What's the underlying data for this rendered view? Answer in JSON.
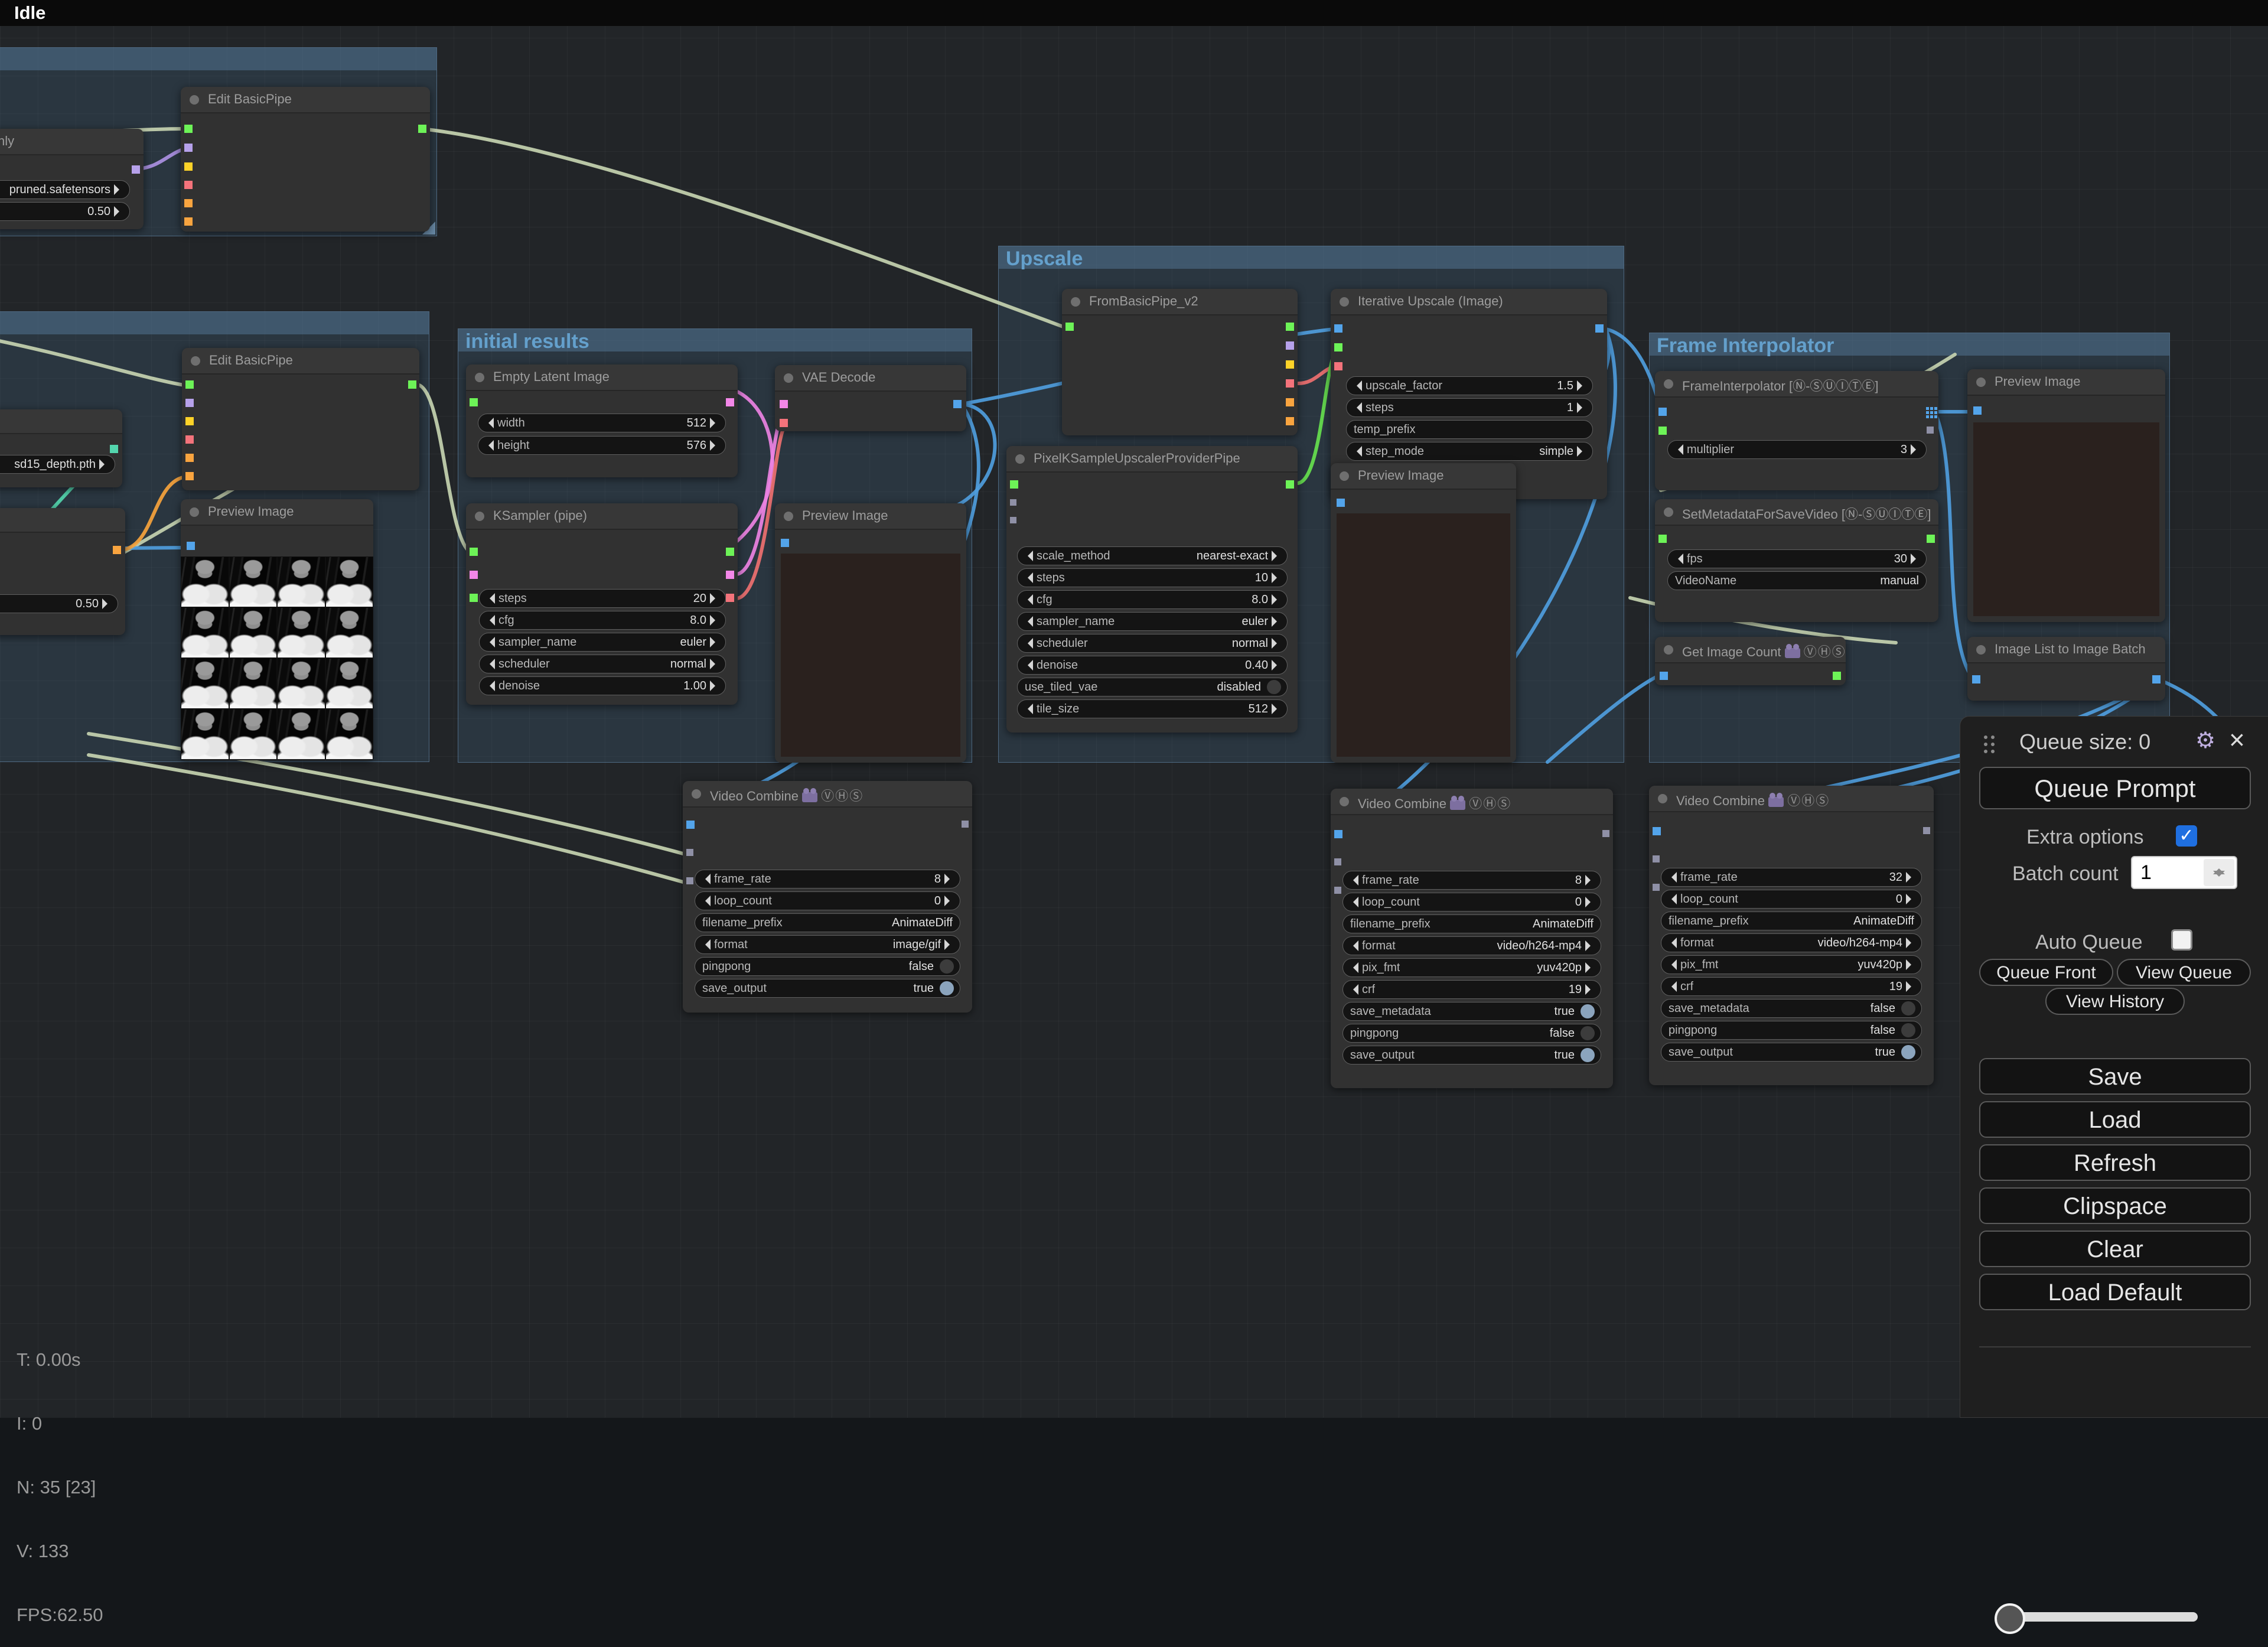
{
  "status_bar": {
    "state": "Idle"
  },
  "palette": {
    "wire_pipe": "#c6d2b0",
    "wire_image": "#4f9ddd",
    "wire_latent": "#ec82e2",
    "wire_vae": "#ee7070",
    "wire_model": "#66e04e",
    "wire_controlnet": "#f6a33c",
    "wire_clip": "#ab90e2",
    "wire_cond": "#54d6ae",
    "group_accent": "#64a0cc",
    "toggle_on": "#8ba4bd",
    "checkbox_on": "#1f6fe0"
  },
  "groups": {
    "initial_results": {
      "title": "initial results"
    },
    "upscale": {
      "title": "Upscale"
    },
    "frame_interpolator": {
      "title": "Frame Interpolator"
    }
  },
  "nodes": {
    "ckpt_partial": {
      "title": "nly",
      "widgets": {
        "ckpt": {
          "value": "pruned.safetensors"
        },
        "ratio": {
          "value": "0.50"
        }
      }
    },
    "edit_basic_pipe_1": {
      "title": "Edit BasicPipe"
    },
    "edit_basic_pipe_2": {
      "title": "Edit BasicPipe"
    },
    "controlnet_partial": {
      "widgets": {
        "model": {
          "value": "sd15_depth.pth"
        }
      }
    },
    "strength_partial": {
      "widgets": {
        "strength": {
          "value": "0.50"
        }
      }
    },
    "preview_left": {
      "title": "Preview Image"
    },
    "empty_latent": {
      "title": "Empty Latent Image",
      "widgets": {
        "width": {
          "label": "width",
          "value": "512"
        },
        "height": {
          "label": "height",
          "value": "576"
        }
      }
    },
    "vae_decode": {
      "title": "VAE Decode"
    },
    "ksampler": {
      "title": "KSampler (pipe)",
      "widgets": {
        "steps": {
          "label": "steps",
          "value": "20"
        },
        "cfg": {
          "label": "cfg",
          "value": "8.0"
        },
        "sampler_name": {
          "label": "sampler_name",
          "value": "euler"
        },
        "scheduler": {
          "label": "scheduler",
          "value": "normal"
        },
        "denoise": {
          "label": "denoise",
          "value": "1.00"
        }
      }
    },
    "preview_initial": {
      "title": "Preview Image"
    },
    "from_basic_pipe": {
      "title": "FromBasicPipe_v2"
    },
    "iterative_upscale": {
      "title": "Iterative Upscale (Image)",
      "widgets": {
        "upscale_factor": {
          "label": "upscale_factor",
          "value": "1.5"
        },
        "steps": {
          "label": "steps",
          "value": "1"
        },
        "temp_prefix": {
          "label": "temp_prefix",
          "value": ""
        },
        "step_mode": {
          "label": "step_mode",
          "value": "simple"
        }
      }
    },
    "pixel_upscaler": {
      "title": "PixelKSampleUpscalerProviderPipe",
      "widgets": {
        "scale_method": {
          "label": "scale_method",
          "value": "nearest-exact"
        },
        "steps": {
          "label": "steps",
          "value": "10"
        },
        "cfg": {
          "label": "cfg",
          "value": "8.0"
        },
        "sampler_name": {
          "label": "sampler_name",
          "value": "euler"
        },
        "scheduler": {
          "label": "scheduler",
          "value": "normal"
        },
        "denoise": {
          "label": "denoise",
          "value": "0.40"
        },
        "use_tiled_vae": {
          "label": "use_tiled_vae",
          "value": "disabled"
        },
        "tile_size": {
          "label": "tile_size",
          "value": "512"
        }
      }
    },
    "preview_upscale": {
      "title": "Preview Image"
    },
    "frame_interpolator": {
      "title": "FrameInterpolator [Ⓝ-ⓈⓊⒾⓉⒺ]",
      "widgets": {
        "multiplier": {
          "label": "multiplier",
          "value": "3"
        }
      }
    },
    "set_metadata": {
      "title": "SetMetadataForSaveVideo [Ⓝ-ⓈⓊⒾⓉⒺ]",
      "widgets": {
        "fps": {
          "label": "fps",
          "value": "30"
        },
        "video_name": {
          "label": "VideoName",
          "value": "manual"
        }
      }
    },
    "get_image_count": {
      "title": "Get Image Count",
      "badge": "ⓋⒽⓈ"
    },
    "image_list_batch": {
      "title": "Image List to Image Batch"
    },
    "preview_frame": {
      "title": "Preview Image"
    },
    "vc1": {
      "title": "Video Combine",
      "badge": "ⓋⒽⓈ",
      "widgets": {
        "frame_rate": {
          "label": "frame_rate",
          "value": "8"
        },
        "loop_count": {
          "label": "loop_count",
          "value": "0"
        },
        "filename_prefix": {
          "label": "filename_prefix",
          "value": "AnimateDiff"
        },
        "format": {
          "label": "format",
          "value": "image/gif"
        },
        "pingpong": {
          "label": "pingpong",
          "value": "false"
        },
        "save_output": {
          "label": "save_output",
          "value": "true"
        }
      }
    },
    "vc2": {
      "title": "Video Combine",
      "badge": "ⓋⒽⓈ",
      "widgets": {
        "frame_rate": {
          "label": "frame_rate",
          "value": "8"
        },
        "loop_count": {
          "label": "loop_count",
          "value": "0"
        },
        "filename_prefix": {
          "label": "filename_prefix",
          "value": "AnimateDiff"
        },
        "format": {
          "label": "format",
          "value": "video/h264-mp4"
        },
        "pix_fmt": {
          "label": "pix_fmt",
          "value": "yuv420p"
        },
        "crf": {
          "label": "crf",
          "value": "19"
        },
        "save_metadata": {
          "label": "save_metadata",
          "value": "true"
        },
        "pingpong": {
          "label": "pingpong",
          "value": "false"
        },
        "save_output": {
          "label": "save_output",
          "value": "true"
        }
      }
    },
    "vc3": {
      "title": "Video Combine",
      "badge": "ⓋⒽⓈ",
      "widgets": {
        "frame_rate": {
          "label": "frame_rate",
          "value": "32"
        },
        "loop_count": {
          "label": "loop_count",
          "value": "0"
        },
        "filename_prefix": {
          "label": "filename_prefix",
          "value": "AnimateDiff"
        },
        "format": {
          "label": "format",
          "value": "video/h264-mp4"
        },
        "pix_fmt": {
          "label": "pix_fmt",
          "value": "yuv420p"
        },
        "crf": {
          "label": "crf",
          "value": "19"
        },
        "save_metadata": {
          "label": "save_metadata",
          "value": "false"
        },
        "pingpong": {
          "label": "pingpong",
          "value": "false"
        },
        "save_output": {
          "label": "save_output",
          "value": "true"
        }
      }
    }
  },
  "menu": {
    "queue_size": "Queue size: 0",
    "queue_prompt": "Queue Prompt",
    "extra_options": "Extra options",
    "batch_count_label": "Batch count",
    "batch_count_value": "1",
    "auto_queue": "Auto Queue",
    "queue_front": "Queue Front",
    "view_queue": "View Queue",
    "view_history": "View History",
    "save": "Save",
    "load": "Load",
    "refresh": "Refresh",
    "clipspace": "Clipspace",
    "clear": "Clear",
    "load_default": "Load Default"
  },
  "stats": {
    "time": "T: 0.00s",
    "iteration": "I: 0",
    "nodes": "N: 35 [23]",
    "v": "V: 133",
    "fps": "FPS:62.50"
  }
}
